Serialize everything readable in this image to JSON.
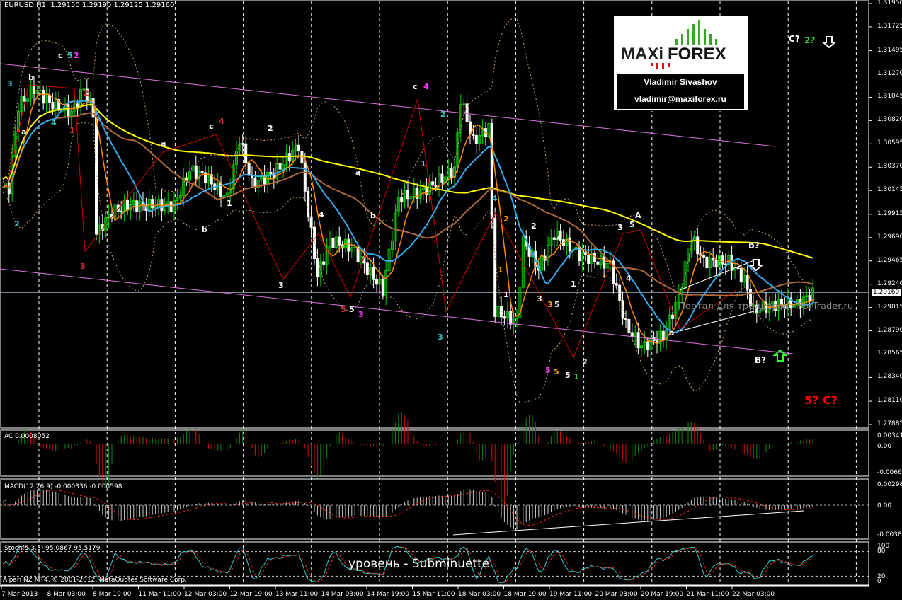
{
  "header": {
    "symbol": "EURUSD,H1",
    "open": "1.29150",
    "high": "1.29190",
    "low": "1.29125",
    "close": "1.29160"
  },
  "price_axis": [
    "1.31950",
    "1.31725",
    "1.31495",
    "1.31270",
    "1.31045",
    "1.30820",
    "1.30595",
    "1.30370",
    "1.30145",
    "1.29915",
    "1.29690",
    "1.29465",
    "1.29240",
    "1.29015",
    "1.28790",
    "1.28565",
    "1.28340",
    "1.28110",
    "1.27885"
  ],
  "current_price": "1.29160",
  "time_axis": [
    "7 Mar 2013",
    "8 Mar 03:00",
    "8 Mar 19:00",
    "11 Mar 11:00",
    "12 Mar 03:00",
    "12 Mar 19:00",
    "13 Mar 11:00",
    "14 Mar 03:00",
    "14 Mar 19:00",
    "15 Mar 11:00",
    "18 Mar 03:00",
    "18 Mar 19:00",
    "19 Mar 11:00",
    "20 Mar 03:00",
    "20 Mar 19:00",
    "21 Mar 11:00",
    "22 Mar 03:00"
  ],
  "logo": {
    "brand_left": "MAXi",
    "brand_right": "FOREX",
    "name": "Vladimir Sivashov",
    "email": "vladimir@maxiforex.ru"
  },
  "watermark": "Портал для трейдеров - ForTrader.ru",
  "caption": "уровень - Subminuette",
  "copyright": "Alpari NZ MT4, © 2001-2012, MetaQuotes Software Corp.",
  "indicators": {
    "ac": {
      "label": "AC 0.0008052",
      "axis": [
        "0.003415",
        "0.00",
        "-0.00667"
      ]
    },
    "macd": {
      "label": "MACD(12,26,9) -0.000336 -0.000598",
      "zero": "0",
      "axis": [
        "0.002986",
        "0.00",
        "-0.003822"
      ]
    },
    "stoch": {
      "label": "Stoch(5,3,3) 95.0867 95.5179",
      "axis": [
        "100",
        "80",
        "20",
        "0"
      ]
    }
  },
  "wave_labels": [
    {
      "text": "3",
      "color": "#33cccc"
    },
    {
      "text": "b",
      "color": "#ffffff"
    },
    {
      "text": "a",
      "color": "#ffffff"
    },
    {
      "text": "4",
      "color": "#33cccc"
    },
    {
      "text": "2",
      "color": "#33cccc"
    },
    {
      "text": "c",
      "color": "#ffffff"
    },
    {
      "text": "5",
      "color": "#33cccc"
    },
    {
      "text": "2",
      "color": "#ff33ff"
    },
    {
      "text": "2",
      "color": "#cc3333"
    },
    {
      "text": "1",
      "color": "#cc3333"
    },
    {
      "text": "3",
      "color": "#cc3333"
    },
    {
      "text": "a",
      "color": "#ffffff"
    },
    {
      "text": "b",
      "color": "#ffffff"
    },
    {
      "text": "c",
      "color": "#ffffff"
    },
    {
      "text": "4",
      "color": "#cc3333"
    },
    {
      "text": "1",
      "color": "#ffffff"
    },
    {
      "text": "2",
      "color": "#ffffff"
    },
    {
      "text": "3",
      "color": "#ffffff"
    },
    {
      "text": "4",
      "color": "#ffffff"
    },
    {
      "text": "5",
      "color": "#cc3333"
    },
    {
      "text": "5",
      "color": "#ffffff"
    },
    {
      "text": "3",
      "color": "#ff33ff"
    },
    {
      "text": "a",
      "color": "#ffffff"
    },
    {
      "text": "b",
      "color": "#ffffff"
    },
    {
      "text": "c",
      "color": "#ffffff"
    },
    {
      "text": "4",
      "color": "#ff33ff"
    },
    {
      "text": "2",
      "color": "#33cccc"
    },
    {
      "text": "1",
      "color": "#33cccc"
    },
    {
      "text": "4",
      "color": "#33cccc"
    },
    {
      "text": "3",
      "color": "#33cccc"
    },
    {
      "text": "1",
      "color": "#ff9900"
    },
    {
      "text": "2",
      "color": "#ff9900"
    },
    {
      "text": "2",
      "color": "#ffffff"
    },
    {
      "text": "1",
      "color": "#ffffff"
    },
    {
      "text": "3",
      "color": "#ffffff"
    },
    {
      "text": "3",
      "color": "#ff9900"
    },
    {
      "text": "5",
      "color": "#ffffff"
    },
    {
      "text": "4",
      "color": "#ffffff"
    },
    {
      "text": "1",
      "color": "#ffffff"
    },
    {
      "text": "5",
      "color": "#ff33ff"
    },
    {
      "text": "5",
      "color": "#ff9900"
    },
    {
      "text": "5",
      "color": "#ffffff"
    },
    {
      "text": "1",
      "color": "#33cc33"
    },
    {
      "text": "2",
      "color": "#ffffff"
    },
    {
      "text": "3",
      "color": "#ffffff"
    },
    {
      "text": "5",
      "color": "#ffffff"
    },
    {
      "text": "A",
      "color": "#ffffff"
    },
    {
      "text": "4",
      "color": "#ffffff"
    },
    {
      "text": "a",
      "color": "#ffffff"
    },
    {
      "text": "b?",
      "color": "#ffffff"
    },
    {
      "text": "B?",
      "color": "#ffffff"
    },
    {
      "text": "C?",
      "color": "#ffffff"
    },
    {
      "text": "2?",
      "color": "#33cc33"
    },
    {
      "text": "5? C?",
      "color": "#ff0000"
    }
  ],
  "colors": {
    "bull": "#00cc00",
    "bear": "#ffffff",
    "ma_slow": "#ffff00",
    "ma_brown": "#b06a3a",
    "ma_blue": "#33aaee",
    "ma_orange": "#ff8800",
    "channel": "#dd77dd",
    "bands": "#c8a070"
  },
  "chart_data": {
    "type": "line",
    "title": "EURUSD,H1",
    "ylim": [
      1.27885,
      1.3195
    ],
    "closes": [
      [
        2,
        1.30174
      ],
      [
        5,
        1.3096
      ],
      [
        10,
        1.3113
      ],
      [
        15,
        1.30994
      ],
      [
        22,
        1.30891
      ],
      [
        26,
        1.3113
      ],
      [
        29,
        1.30891
      ],
      [
        30,
        1.2973
      ],
      [
        35,
        1.29935
      ],
      [
        40,
        1.30003
      ],
      [
        50,
        1.30003
      ],
      [
        55,
        1.30003
      ],
      [
        60,
        1.30345
      ],
      [
        65,
        1.30277
      ],
      [
        72,
        1.30072
      ],
      [
        76,
        1.30652
      ],
      [
        80,
        1.30208
      ],
      [
        87,
        1.30311
      ],
      [
        95,
        1.30584
      ],
      [
        97,
        1.3014
      ],
      [
        101,
        1.2932
      ],
      [
        105,
        1.29662
      ],
      [
        112,
        1.29594
      ],
      [
        122,
        1.29184
      ],
      [
        127,
        1.30072
      ],
      [
        135,
        1.3014
      ],
      [
        145,
        1.30345
      ],
      [
        147,
        1.3103
      ],
      [
        151,
        1.30618
      ],
      [
        156,
        1.30755
      ],
      [
        158,
        1.28979
      ],
      [
        165,
        1.28877
      ],
      [
        167,
        1.29662
      ],
      [
        172,
        1.29389
      ],
      [
        177,
        1.2973
      ],
      [
        185,
        1.29525
      ],
      [
        195,
        1.29423
      ],
      [
        200,
        1.28842
      ],
      [
        205,
        1.28637
      ],
      [
        212,
        1.2874
      ],
      [
        217,
        1.29115
      ],
      [
        221,
        1.29696
      ],
      [
        225,
        1.29457
      ],
      [
        233,
        1.29457
      ],
      [
        238,
        1.29286
      ],
      [
        241,
        1.28979
      ],
      [
        247,
        1.29047
      ],
      [
        255,
        1.29047
      ],
      [
        260,
        1.2915
      ]
    ]
  }
}
